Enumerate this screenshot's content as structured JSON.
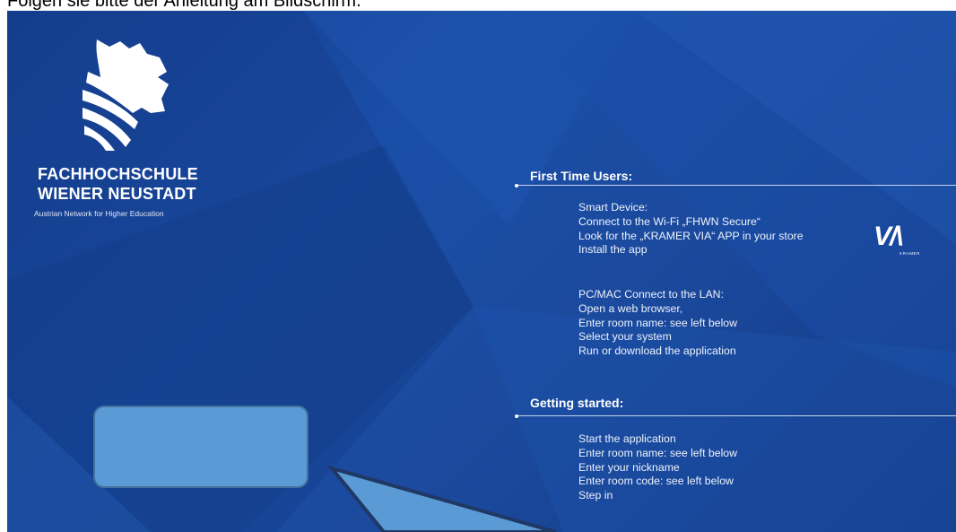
{
  "top_caption": "Folgen sie bitte der Anleitung am Bildschirm.",
  "brand": {
    "line1": "FACHHOCHSCHULE",
    "line2": "WIENER NEUSTADT",
    "subtitle": "Austrian Network for Higher Education"
  },
  "first_time": {
    "title": "First Time Users:",
    "smart_device": [
      "Smart Device:",
      "Connect to the Wi-Fi „FHWN Secure“",
      "Look for the „KRAMER VIA“ APP in your store",
      "Install the app"
    ],
    "pc_mac": [
      "PC/MAC Connect to the LAN:",
      "Open a web browser,",
      "Enter room name: see left below",
      "Select your system",
      "Run or download the application"
    ]
  },
  "getting_started": {
    "title": "Getting started:",
    "steps": [
      "Start the application",
      "Enter room name: see left below",
      "Enter your nickname",
      "Enter room code: see left below",
      "Step in"
    ]
  },
  "via_logo": {
    "text": "V/\\",
    "sub": "KRAMER"
  },
  "colors": {
    "background": "#1a4fa8",
    "box_fill": "#5b9bd5",
    "box_border": "#41719c"
  }
}
